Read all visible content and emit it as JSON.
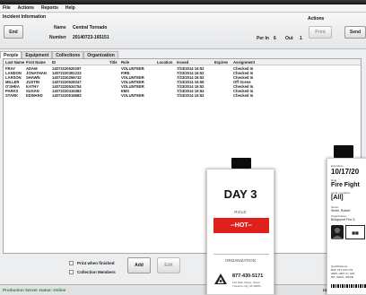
{
  "menu": [
    "File",
    "Actions",
    "Reports",
    "Help"
  ],
  "incident": {
    "section_title": "Incident Information",
    "end_button": "End",
    "name_label": "Name",
    "name_value": "Central Tornado",
    "number_label": "Number",
    "number_value": "20140723-165151",
    "per_in_label": "Per In",
    "per_in_value": "6",
    "out_label": "Out",
    "out_value": "1"
  },
  "actions": {
    "section_title": "Actions",
    "print_button": "Print",
    "send_button": "Send"
  },
  "tabs": [
    "People",
    "Equipment",
    "Collections",
    "Organization"
  ],
  "table": {
    "headers": [
      "Last Name",
      "First Name",
      "ID",
      "Title",
      "Role",
      "Location",
      "Issued",
      "Expires",
      "Assignment"
    ],
    "rows": [
      [
        "FRAY",
        "ADAM",
        "14072220520297",
        "",
        "VOLUNTEER",
        "",
        "7/23/2014 16:52",
        "",
        "Checked In"
      ],
      [
        "LANDON",
        "JONATHAN",
        "14072220381223",
        "",
        "FIRE",
        "",
        "7/23/2014 16:52",
        "",
        "Checked In"
      ],
      [
        "LARSON",
        "SHAWN",
        "14072220256732",
        "",
        "VOLUNTEER",
        "",
        "7/23/2014 16:52",
        "",
        "Checked In"
      ],
      [
        "MILLER",
        "JUSTIN",
        "14072220528347",
        "",
        "VOLUNTEER",
        "",
        "7/23/2014 16:55",
        "",
        "Off Scene"
      ],
      [
        "O'SHEA",
        "KATHY",
        "14072220534754",
        "",
        "VOLUNTEER",
        "",
        "7/23/2014 16:52",
        "",
        "Checked In"
      ],
      [
        "PARKS",
        "SUSAN",
        "14072220415383",
        "",
        "EMS",
        "",
        "7/23/2014 16:54",
        "",
        "Checked In"
      ],
      [
        "STARK",
        "EDWARD",
        "14072220519683",
        "",
        "VOLUNTEER",
        "",
        "7/23/2014 16:52",
        "",
        "Checked In"
      ]
    ]
  },
  "footer": {
    "print_when_finished": "Print when finished",
    "collection_members": "Collection Members",
    "add_button": "Add",
    "edit_button": "Edit"
  },
  "status": {
    "server": "Production Server status: Online",
    "right_text": "nnected",
    "right_tail": "Fi"
  },
  "badge_day": {
    "title": "DAY 3",
    "role_label": "ROLE",
    "role_value": "--HOT--",
    "org_label": "ORGANIZATION",
    "phone": "877-430-5171",
    "address_line1": "123 Main Street, Street",
    "address_line2": "Traverse City, MI 49684",
    "accent": "#e0211b"
  },
  "badge_id": {
    "expiration_label": "Expiration:",
    "expiration_value": "10/17/20",
    "role_label": "Role:",
    "role_value": "Fire Fight",
    "level_label": "Level / Location:",
    "level_value": "[All]",
    "name_label": "Name:",
    "name_value": "Smith, Robert",
    "org_label": "Organization:",
    "org_value": "Bridgeport Fire D",
    "quals_label": "Qualifications:",
    "quals_line1": "DAT, FFI, FFII, FS",
    "quals_line2": "HMO, HMT, IC, HM",
    "quals_line3": "RIT, VEHX, WFCE"
  }
}
